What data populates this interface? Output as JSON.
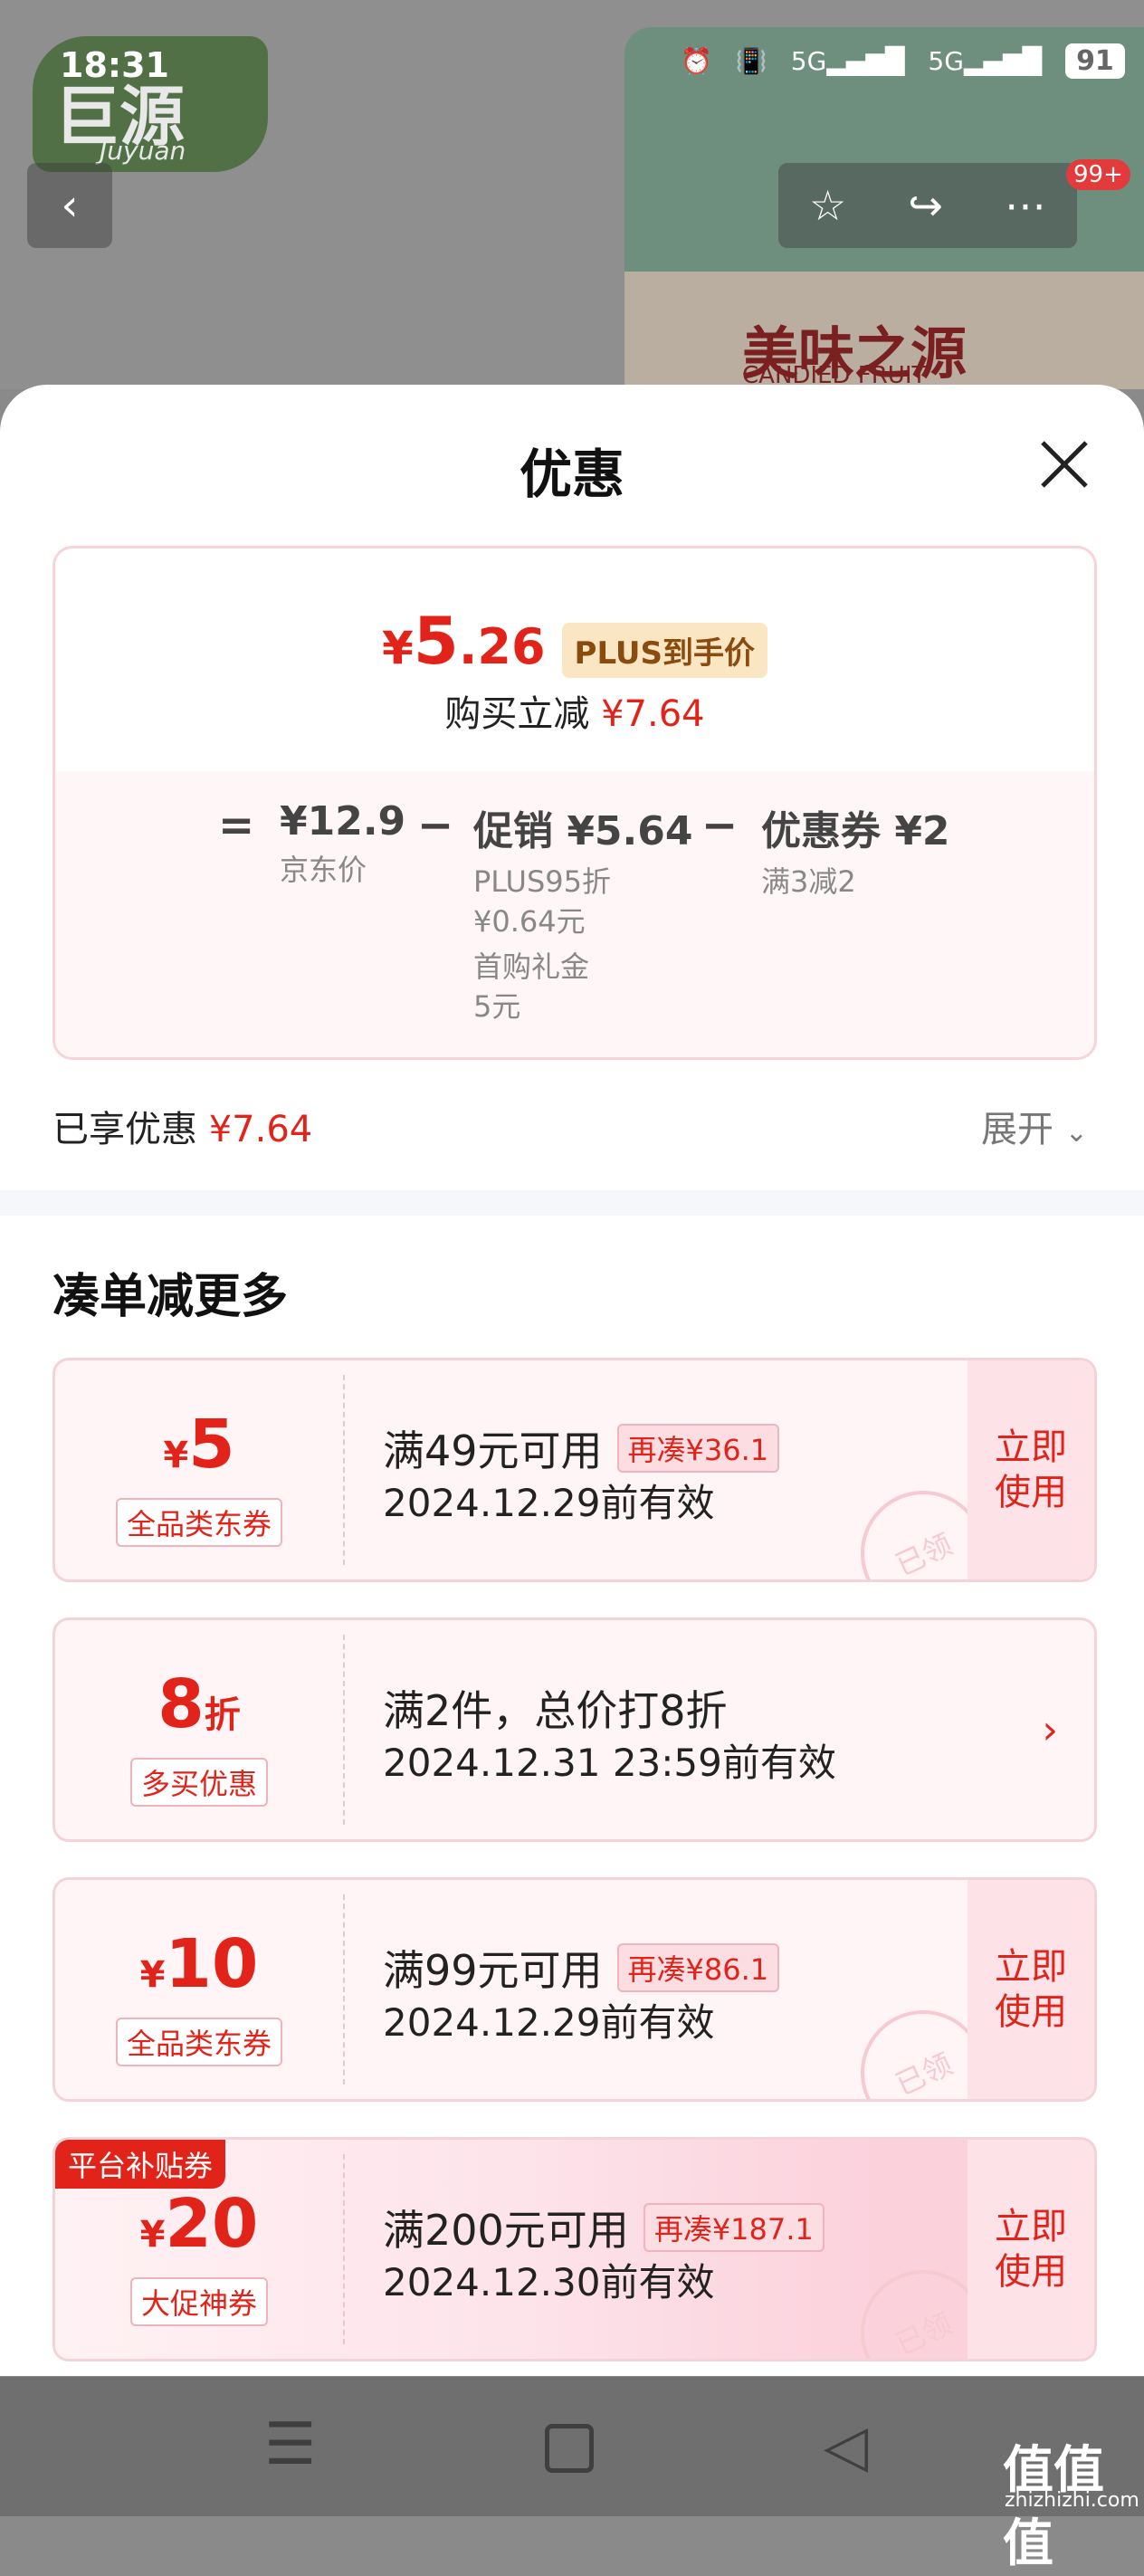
{
  "status_bar": {
    "time": "18:31",
    "signal1": "5G",
    "signal2": "5G",
    "battery": "91"
  },
  "background": {
    "brand_logo": "巨源",
    "brand_logo_sub": "Juyuan",
    "product_title": "美味之源",
    "product_subtitle": "CANDIED FRUIT",
    "cart_badge": "99+"
  },
  "sheet": {
    "title": "优惠",
    "summary": {
      "final_price_yen": "¥",
      "final_price_int": "5",
      "final_price_dec": ".26",
      "plus_tag": "PLUS到手价",
      "reduce_label": "购买立减",
      "reduce_amount": "¥7.64",
      "equals": "=",
      "jd_price": "¥12.9",
      "jd_price_label": "京东价",
      "minus1": "−",
      "promo": "促销 ¥5.64",
      "promo_line1": "PLUS95折",
      "promo_line2": "¥0.64元",
      "promo_line3": "首购礼金",
      "promo_line4": "5元",
      "minus2": "−",
      "coupon": "优惠券 ¥2",
      "coupon_detail": "满3减2"
    },
    "enjoyed_label": "已享优惠",
    "enjoyed_amount": "¥7.64",
    "expand_label": "展开"
  },
  "section_title": "凑单减更多",
  "coupons": [
    {
      "yen": "¥",
      "amount": "5",
      "unit": "",
      "tag": "全品类东券",
      "line1": "满49元可用",
      "chip": "再凑¥36.1",
      "line2": "2024.12.29前有效",
      "action": "立即使用",
      "stamp": "已领"
    },
    {
      "yen": "",
      "amount": "8",
      "unit": "折",
      "tag": "多买优惠",
      "line1": "满2件，总价打8折",
      "chip": "",
      "line2": "2024.12.31 23:59前有效",
      "action": "",
      "stamp": ""
    },
    {
      "yen": "¥",
      "amount": "10",
      "unit": "",
      "tag": "全品类东券",
      "line1": "满99元可用",
      "chip": "再凑¥86.1",
      "line2": "2024.12.29前有效",
      "action": "立即使用",
      "stamp": "已领"
    },
    {
      "yen": "¥",
      "amount": "20",
      "unit": "",
      "tag": "大促神券",
      "corner": "平台补贴券",
      "line1": "满200元可用",
      "chip": "再凑¥187.1",
      "line2": "2024.12.30前有效",
      "action": "立即使用",
      "stamp": "已领"
    }
  ],
  "watermark": {
    "text": "值值值",
    "sub": "zhizhizhi.com"
  }
}
